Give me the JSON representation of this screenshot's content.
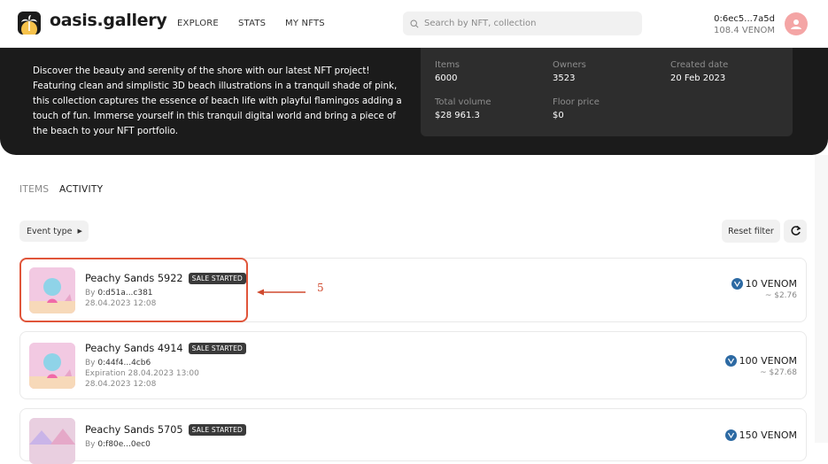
{
  "header": {
    "logo_text": "oasis.gallery",
    "nav": [
      "EXPLORE",
      "STATS",
      "MY NFTS"
    ],
    "search_placeholder": "Search by NFT, collection",
    "account": {
      "address": "0:6ec5...7a5d",
      "balance": "108.4 VENOM"
    }
  },
  "hero": {
    "description": "Discover the beauty and serenity of the shore with our latest NFT project! Featuring clean and simplistic 3D beach illustrations in a tranquil shade of pink, this collection captures the essence of beach life with playful flamingos adding a touch of fun. Immerse yourself in this tranquil digital world and bring a piece of the beach to your NFT portfolio.",
    "stats": {
      "items_label": "Items",
      "items_value": "6000",
      "owners_label": "Owners",
      "owners_value": "3523",
      "created_label": "Created date",
      "created_value": "20 Feb 2023",
      "volume_label": "Total volume",
      "volume_value": "$28 961.3",
      "floor_label": "Floor price",
      "floor_value": "$0"
    }
  },
  "tabs": {
    "items": "ITEMS",
    "activity": "ACTIVITY",
    "active": "ACTIVITY"
  },
  "filters": {
    "event_type": "Event type",
    "reset": "Reset filter"
  },
  "activity": [
    {
      "title": "Peachy Sands 5922",
      "badge": "SALE STARTED",
      "by_prefix": "By",
      "by": "0:d51a...c381",
      "line2": "28.04.2023 12:08",
      "line3": "",
      "price": "10 VENOM",
      "usd": "~ $2.76"
    },
    {
      "title": "Peachy Sands 4914",
      "badge": "SALE STARTED",
      "by_prefix": "By",
      "by": "0:44f4...4cb6",
      "line2": "Expiration 28.04.2023 13:00",
      "line3": "28.04.2023 12:08",
      "price": "100 VENOM",
      "usd": "~ $27.68"
    },
    {
      "title": "Peachy Sands 5705",
      "badge": "SALE STARTED",
      "by_prefix": "By",
      "by": "0:f80e...0ec0",
      "line2": "",
      "line3": "",
      "price": "150 VENOM",
      "usd": ""
    }
  ],
  "annotation": {
    "label": "5",
    "color": "#d04a2e"
  },
  "colors": {
    "dark": "#1b1b1b",
    "stats_panel": "#2d2d2d",
    "venom": "#2d6aa3",
    "accent_avatar": "#f4a5a5"
  }
}
